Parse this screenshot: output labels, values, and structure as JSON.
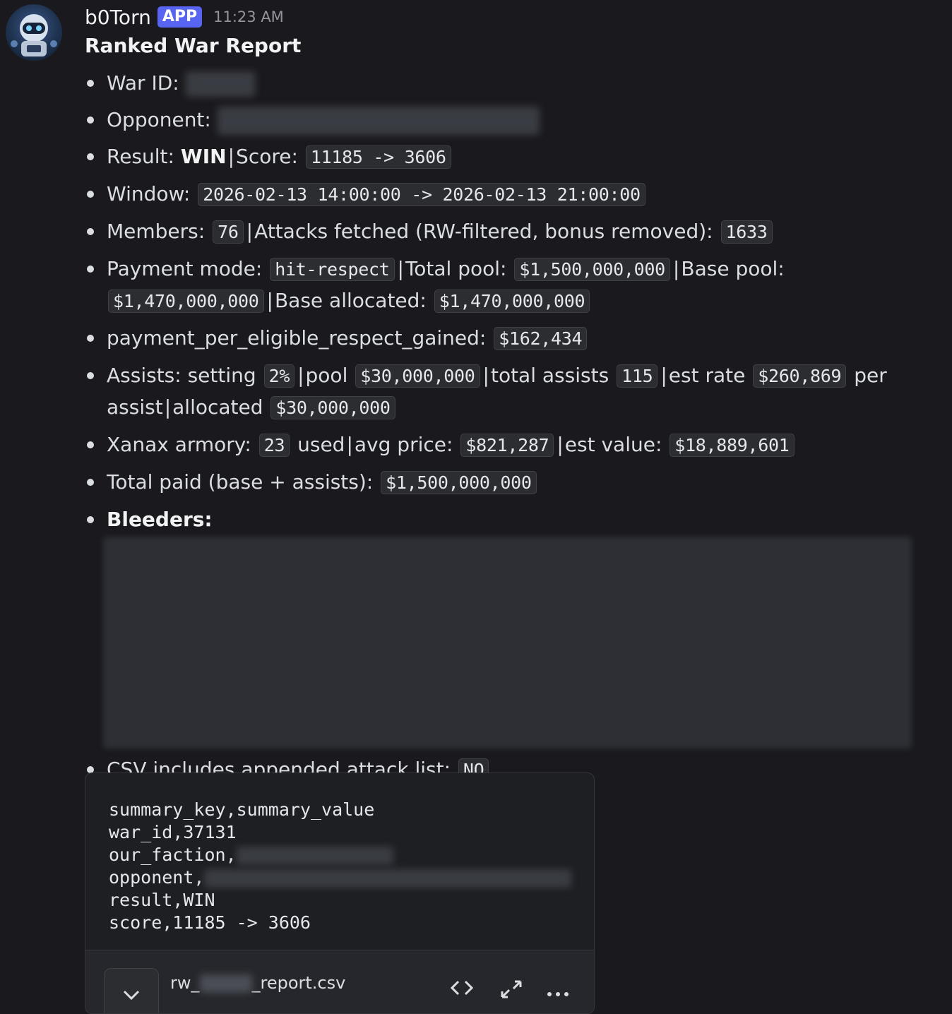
{
  "message": {
    "username": "b0Torn",
    "badge": "APP",
    "timestamp": "11:23 AM",
    "title": "Ranked War Report"
  },
  "report": {
    "war_id_label": "War ID:",
    "opponent_label": "Opponent:",
    "result_label": "Result:",
    "result_value": "WIN",
    "score_label": "Score:",
    "score_value": "11185 -> 3606",
    "window_label": "Window:",
    "window_value": "2026-02-13 14:00:00 -> 2026-02-13 21:00:00",
    "members_label": "Members:",
    "members_value": "76",
    "attacks_label": "Attacks fetched (RW-filtered, bonus removed):",
    "attacks_value": "1633",
    "payment_mode_label": "Payment mode:",
    "payment_mode_value": "hit-respect",
    "total_pool_label": "Total pool:",
    "total_pool_value": "$1,500,000,000",
    "base_pool_label": "Base pool:",
    "base_pool_value": "$1,470,000,000",
    "base_allocated_label": "Base allocated:",
    "base_allocated_value": "$1,470,000,000",
    "ppr_label": "payment_per_eligible_respect_gained:",
    "ppr_value": "$162,434",
    "assists_label": "Assists: setting",
    "assists_setting": "2%",
    "assists_pool_label": "pool",
    "assists_pool_value": "$30,000,000",
    "total_assists_label": "total assists",
    "total_assists_value": "115",
    "est_rate_label": "est rate",
    "est_rate_value": "$260,869",
    "per_assist_label": "per assist",
    "allocated_label": "allocated",
    "allocated_value": "$30,000,000",
    "xanax_label": "Xanax armory:",
    "xanax_used": "23",
    "used_label": "used",
    "avg_price_label": "avg price:",
    "avg_price_value": "$821,287",
    "est_value_label": "est value:",
    "est_value_value": "$18,889,601",
    "total_paid_label": "Total paid (base + assists):",
    "total_paid_value": "$1,500,000,000",
    "bleeders_label": "Bleeders:",
    "csv_label": "CSV includes appended attack list:",
    "csv_value": "NO"
  },
  "csv_preview": {
    "line1": "summary_key,summary_value",
    "line2": "war_id,37131",
    "line3": "our_faction,",
    "line4": "opponent,",
    "line5": "result,WIN",
    "line6": "score,11185 -> 3606"
  },
  "attachment": {
    "prefix": "rw_",
    "suffix": "_report.csv",
    "icons": [
      "chevron-down-icon",
      "code-icon",
      "expand-icon",
      "more-icon"
    ]
  }
}
